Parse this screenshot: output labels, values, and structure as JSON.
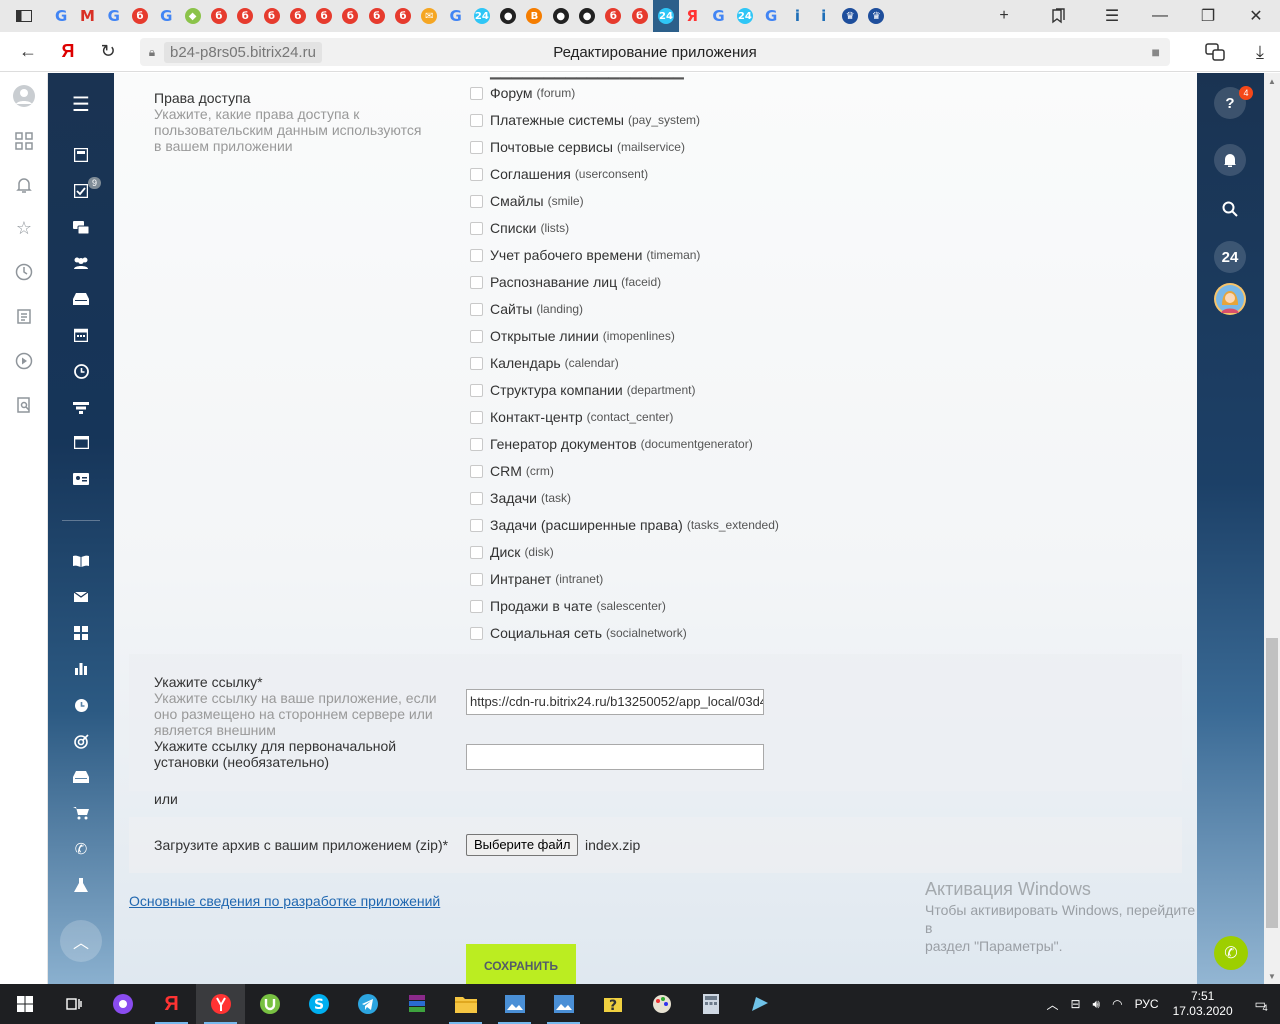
{
  "browser": {
    "tab_icons": [
      "google",
      "gmail",
      "google",
      "yandex-red",
      "google",
      "android",
      "yandex-red",
      "yandex-red",
      "yandex-red",
      "yandex-red",
      "yandex-red",
      "yandex-red",
      "yandex-red",
      "yandex-red",
      "mail",
      "google",
      "bitrix24",
      "github",
      "blogger",
      "github",
      "github",
      "yandex-red",
      "yandex-red",
      "bitrix24",
      "yandex",
      "google",
      "bitrix24",
      "google",
      "info",
      "info",
      "emblem",
      "emblem"
    ],
    "active_tab_index": 23,
    "domain": "b24-p8rs05.bitrix24.ru",
    "page_title": "Редактирование приложения",
    "yandex_letter": "Я"
  },
  "form": {
    "rights_title": "Права доступа",
    "rights_desc": "Укажите, какие права доступа к пользовательским данным используются в вашем приложении",
    "permissions": [
      {
        "label": "Форум",
        "code": "(forum)"
      },
      {
        "label": "Платежные системы",
        "code": "(pay_system)"
      },
      {
        "label": "Почтовые сервисы",
        "code": "(mailservice)"
      },
      {
        "label": "Соглашения",
        "code": "(userconsent)"
      },
      {
        "label": "Смайлы",
        "code": "(smile)"
      },
      {
        "label": "Списки",
        "code": "(lists)"
      },
      {
        "label": "Учет рабочего времени",
        "code": "(timeman)"
      },
      {
        "label": "Распознавание лиц",
        "code": "(faceid)"
      },
      {
        "label": "Сайты",
        "code": "(landing)"
      },
      {
        "label": "Открытые линии",
        "code": "(imopenlines)"
      },
      {
        "label": "Календарь",
        "code": "(calendar)"
      },
      {
        "label": "Структура компании",
        "code": "(department)"
      },
      {
        "label": "Контакт-центр",
        "code": "(contact_center)"
      },
      {
        "label": "Генератор документов",
        "code": "(documentgenerator)"
      },
      {
        "label": "CRM",
        "code": "(crm)"
      },
      {
        "label": "Задачи",
        "code": "(task)"
      },
      {
        "label": "Задачи (расширенные права)",
        "code": "(tasks_extended)"
      },
      {
        "label": "Диск",
        "code": "(disk)"
      },
      {
        "label": "Интранет",
        "code": "(intranet)"
      },
      {
        "label": "Продажи в чате",
        "code": "(salescenter)"
      },
      {
        "label": "Социальная сеть",
        "code": "(socialnetwork)"
      }
    ],
    "link_title": "Укажите ссылку*",
    "link_desc": "Укажите ссылку на ваше приложение, если оно размещено на стороннем сервере или является внешним",
    "link_value": "https://cdn-ru.bitrix24.ru/b13250052/app_local/03d4",
    "install_title": "Укажите ссылку для первоначальной установки (необязательно)",
    "install_value": "",
    "or_text": "или",
    "zip_label": "Загрузите архив с вашим приложением (zip)*",
    "file_button": "Выберите файл",
    "file_name": "index.zip",
    "dev_link": "Основные сведения по разработке приложений",
    "save_button": "СОХРАНИТЬ"
  },
  "menu": {
    "tasks_badge": "9"
  },
  "rightpanel": {
    "help_badge": "4",
    "b24_label": "24"
  },
  "watermark": {
    "title": "Активация Windows",
    "line1": "Чтобы активировать Windows, перейдите в",
    "line2": "раздел \"Параметры\"."
  },
  "taskbar": {
    "lang": "РУС",
    "time": "7:51",
    "date": "17.03.2020",
    "notif_count": "4"
  },
  "colors": {
    "save_green": "#bbed21",
    "link_blue": "#2067b0",
    "menu_dark": "#1a3352"
  }
}
